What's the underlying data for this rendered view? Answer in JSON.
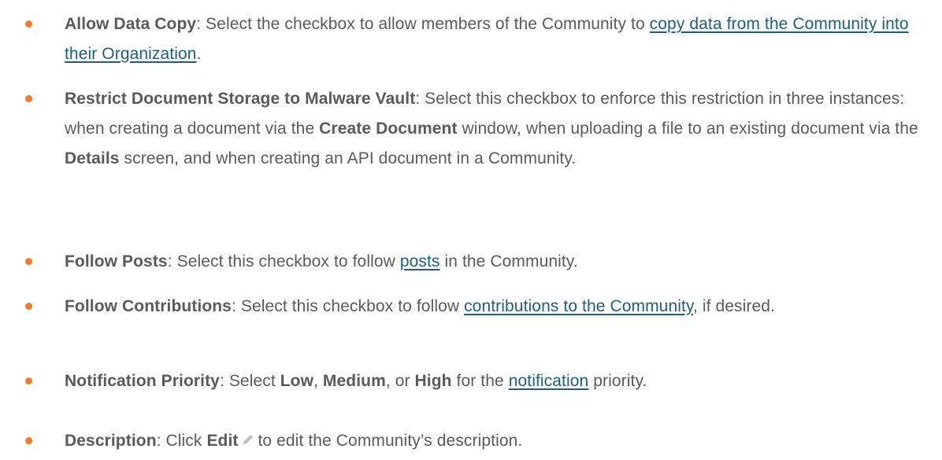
{
  "items": [
    {
      "term": "Allow Data Copy",
      "t1": ": Select the checkbox to allow members of the Community to ",
      "link": "copy data from the Community into their Organization",
      "t2": "."
    },
    {
      "term": "Restrict Document Storage to Malware Vault",
      "t1": ": Select this checkbox to enforce this restriction in three instances: when creating a document via the ",
      "b1": "Create Document",
      "t2": " window, when uploading a file to an existing document via the ",
      "b2": "Details",
      "t3": " screen, and when creating an API document in a Community."
    },
    {
      "term": "Follow Posts",
      "t1": ": Select this checkbox to follow ",
      "link": "posts",
      "t2": " in the Community."
    },
    {
      "term": "Follow Contributions",
      "t1": ": Select this checkbox to follow ",
      "link": "contributions to the Community",
      "t2": ", if desired."
    },
    {
      "term": "Notification Priority",
      "t1": ": Select ",
      "b1": "Low",
      "t2": ", ",
      "b2": "Medium",
      "t3": ", or ",
      "b3": "High",
      "t4": " for the ",
      "link": "notification",
      "t5": " priority."
    },
    {
      "term": "Description",
      "t1": ": Click ",
      "b1": "Edit",
      "icon": "pencil-icon",
      "t2": "to edit the Community’s description."
    }
  ],
  "colors": {
    "bullet": "#ee7b2e",
    "link": "#1e5f7a",
    "text": "#5a5a5a"
  }
}
